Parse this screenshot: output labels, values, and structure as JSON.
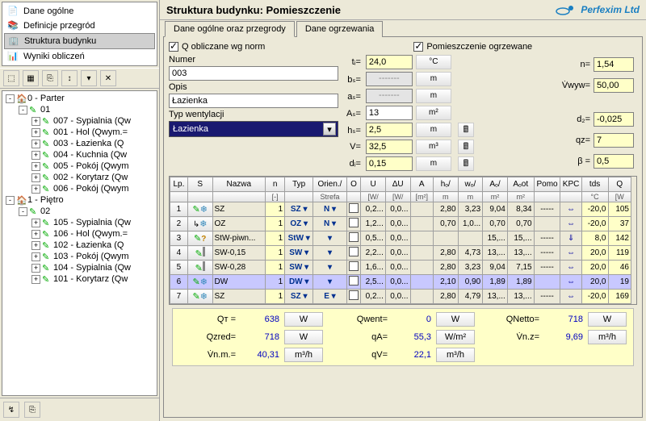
{
  "nav": {
    "items": [
      {
        "label": "Dane ogólne"
      },
      {
        "label": "Definicje przegród"
      },
      {
        "label": "Struktura budynku"
      },
      {
        "label": "Wyniki obliczeń"
      }
    ]
  },
  "tree": [
    {
      "depth": 0,
      "toggle": "-",
      "icon": "house",
      "label": "0 - Parter"
    },
    {
      "depth": 1,
      "toggle": "-",
      "icon": "pencil",
      "label": "01"
    },
    {
      "depth": 2,
      "toggle": "+",
      "icon": "pencil",
      "label": "007 - Sypialnia (Qw"
    },
    {
      "depth": 2,
      "toggle": "+",
      "icon": "pencil",
      "label": "001 - Hol (Qwym.="
    },
    {
      "depth": 2,
      "toggle": "+",
      "icon": "pencil",
      "label": "003 - Łazienka (Q"
    },
    {
      "depth": 2,
      "toggle": "+",
      "icon": "pencil",
      "label": "004 - Kuchnia (Qw"
    },
    {
      "depth": 2,
      "toggle": "+",
      "icon": "pencil",
      "label": "005 - Pokój (Qwym"
    },
    {
      "depth": 2,
      "toggle": "+",
      "icon": "pencil",
      "label": "002 - Korytarz (Qw"
    },
    {
      "depth": 2,
      "toggle": "+",
      "icon": "pencil",
      "label": "006 - Pokój (Qwym"
    },
    {
      "depth": 0,
      "toggle": "-",
      "icon": "house",
      "label": "1 - Piętro"
    },
    {
      "depth": 1,
      "toggle": "-",
      "icon": "pencil",
      "label": "02"
    },
    {
      "depth": 2,
      "toggle": "+",
      "icon": "pencil",
      "label": "105 - Sypialnia (Qw"
    },
    {
      "depth": 2,
      "toggle": "+",
      "icon": "pencil",
      "label": "106 - Hol (Qwym.="
    },
    {
      "depth": 2,
      "toggle": "+",
      "icon": "pencil",
      "label": "102 - Łazienka (Q"
    },
    {
      "depth": 2,
      "toggle": "+",
      "icon": "pencil",
      "label": "103 - Pokój (Qwym"
    },
    {
      "depth": 2,
      "toggle": "+",
      "icon": "pencil",
      "label": "104 - Sypialnia (Qw"
    },
    {
      "depth": 2,
      "toggle": "+",
      "icon": "pencil",
      "label": "101 - Korytarz (Qw"
    }
  ],
  "title": "Struktura budynku: Pomieszczenie",
  "brand": "Perfexim Ltd",
  "tabs": {
    "t1": "Dane ogólne oraz przegrody",
    "t2": "Dane ogrzewania"
  },
  "form": {
    "chk_q": "Q obliczane wg norm",
    "chk_heated": "Pomieszczenie ogrzewane",
    "numer_lbl": "Numer",
    "numer": "003",
    "opis_lbl": "Opis",
    "opis": "Łazienka",
    "typ_lbl": "Typ wentylacji",
    "typ_val": "Łazienka"
  },
  "params": {
    "ti_lbl": "tᵢ=",
    "ti": "24,0",
    "ti_u": "°C",
    "bs_lbl": "bₛ=",
    "bs": "-------",
    "bs_u": "m",
    "as_lbl": "aₛ=",
    "as": "-------",
    "as_u": "m",
    "As_lbl": "Aₛ=",
    "As": "13",
    "As_u": "m²",
    "hs_lbl": "hₛ=",
    "hs": "2,5",
    "hs_u": "m",
    "V_lbl": "V=",
    "V": "32,5",
    "V_u": "m³",
    "di_lbl": "dᵢ=",
    "di": "0,15",
    "di_u": "m",
    "n_lbl": "n=",
    "n": "1,54",
    "Vwyw_lbl": "V̇wyw=",
    "Vwyw": "50,00",
    "d2_lbl": "d₂=",
    "d2": "-0,025",
    "qz_lbl": "qz=",
    "qz": "7",
    "B_lbl": "β =",
    "B": "0,5"
  },
  "grid": {
    "headers": [
      "Lp.",
      "S",
      "Nazwa",
      "n",
      "Typ",
      "Orien./",
      "O",
      "U",
      "ΔU",
      "A",
      "hₒ/",
      "wₒ/",
      "Aₒ/",
      "Aₒot",
      "Pomo",
      "KPC",
      "tds",
      "Q"
    ],
    "sub": [
      "",
      "",
      "",
      "[-]",
      "",
      "Strefa",
      "",
      "[W/",
      "[W/",
      "[m²]",
      "m",
      "m",
      "m²",
      "m²",
      "",
      "",
      "°C",
      "[W"
    ],
    "rows": [
      {
        "lp": "1",
        "s": "ps",
        "name": "SZ",
        "n": "1",
        "typ": "SZ",
        "orien": "N",
        "o": "",
        "U": "0,2...",
        "dU": "0,0...",
        "A": "",
        "ho": "2,80",
        "wo": "3,23",
        "Ao": "9,04",
        "Aoot": "8,34",
        "pomo": "-----",
        "kpc": "⇔",
        "tds": "-20,0",
        "Q": "105"
      },
      {
        "lp": "2",
        "s": "hs",
        "name": "OZ",
        "n": "1",
        "typ": "OZ",
        "orien": "N",
        "o": "",
        "U": "1,2...",
        "dU": "0,0...",
        "A": "",
        "ho": "0,70",
        "wo": "1,0...",
        "Ao": "0,70",
        "Aoot": "0,70",
        "pomo": "",
        "kpc": "⇔",
        "tds": "-20,0",
        "Q": "37"
      },
      {
        "lp": "3",
        "s": "pq",
        "name": "StW-piwn...",
        "n": "1",
        "typ": "StW",
        "orien": "",
        "o": "",
        "U": "0,5...",
        "dU": "0,0...",
        "A": "",
        "ho": "",
        "wo": "",
        "Ao": "15,...",
        "Aoot": "15,...",
        "pomo": "-----",
        "kpc": "⇓",
        "tds": "8,0",
        "Q": "142"
      },
      {
        "lp": "4",
        "s": "pb",
        "name": "SW-0,15",
        "n": "1",
        "typ": "SW",
        "orien": "",
        "o": "",
        "U": "2,2...",
        "dU": "0,0...",
        "A": "",
        "ho": "2,80",
        "wo": "4,73",
        "Ao": "13,...",
        "Aoot": "13,...",
        "pomo": "-----",
        "kpc": "⇔",
        "tds": "20,0",
        "Q": "119"
      },
      {
        "lp": "5",
        "s": "pb",
        "name": "SW-0,28",
        "n": "1",
        "typ": "SW",
        "orien": "",
        "o": "",
        "U": "1,6...",
        "dU": "0,0...",
        "A": "",
        "ho": "2,80",
        "wo": "3,23",
        "Ao": "9,04",
        "Aoot": "7,15",
        "pomo": "-----",
        "kpc": "⇔",
        "tds": "20,0",
        "Q": "46"
      },
      {
        "lp": "6",
        "s": "ps",
        "name": "DW",
        "n": "1",
        "typ": "DW",
        "orien": "",
        "o": "",
        "U": "2,5...",
        "dU": "0,0...",
        "A": "",
        "ho": "2,10",
        "wo": "0,90",
        "Ao": "1,89",
        "Aoot": "1,89",
        "pomo": "",
        "kpc": "⇔",
        "tds": "20,0",
        "Q": "19",
        "sel": true
      },
      {
        "lp": "7",
        "s": "ps",
        "name": "SZ",
        "n": "1",
        "typ": "SZ",
        "orien": "E",
        "o": "",
        "U": "0,2...",
        "dU": "0,0...",
        "A": "",
        "ho": "2,80",
        "wo": "4,79",
        "Ao": "13,...",
        "Aoot": "13,...",
        "pomo": "-----",
        "kpc": "⇔",
        "tds": "-20,0",
        "Q": "169"
      }
    ]
  },
  "summary": {
    "QT_lbl": "Qᴛ =",
    "QT": "638",
    "QT_u": "W",
    "Qwent_lbl": "Qwent=",
    "Qwent": "0",
    "Qwent_u": "W",
    "QNetto_lbl": "QNetto=",
    "QNetto": "718",
    "QNetto_u": "W",
    "Qzred_lbl": "Qzred=",
    "Qzred": "718",
    "Qzred_u": "W",
    "qA_lbl": "qA=",
    "qA": "55,3",
    "qA_u": "W/m²",
    "Vnz_lbl": "V̇n.z=",
    "Vnz": "9,69",
    "Vnz_u": "m³/h",
    "Vnm_lbl": "V̇n.m.=",
    "Vnm": "40,31",
    "Vnm_u": "m³/h",
    "qV_lbl": "qV=",
    "qV": "22,1",
    "qV_u": "m³/h"
  }
}
